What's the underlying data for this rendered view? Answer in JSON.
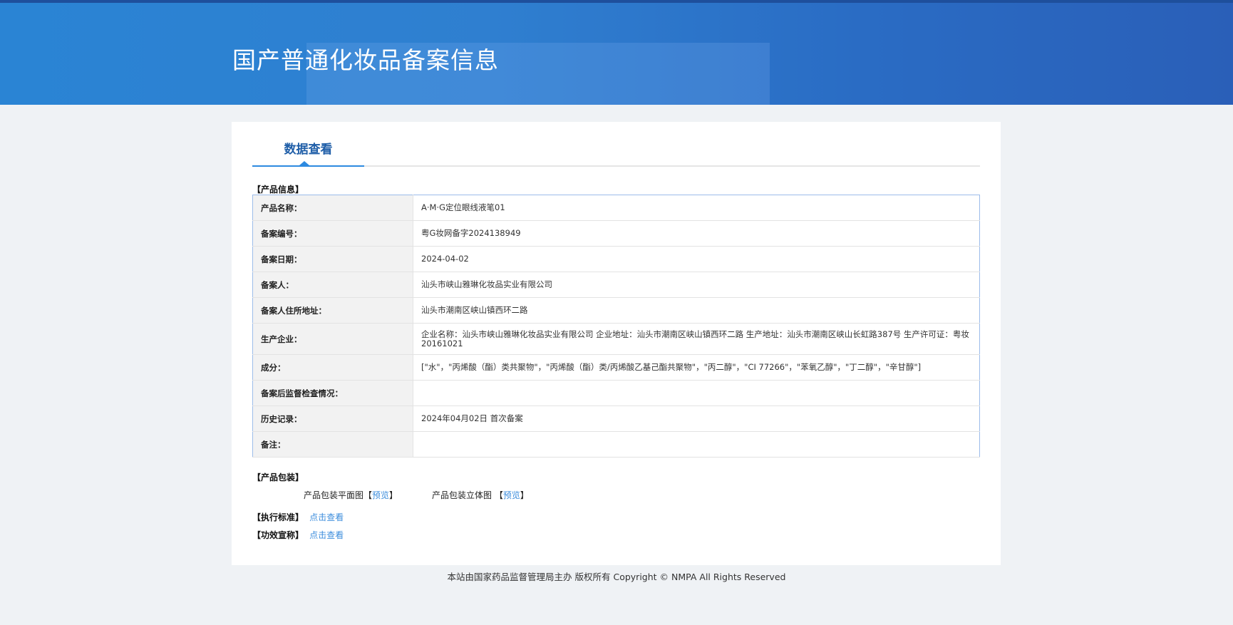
{
  "header": {
    "title": "国产普通化妆品备案信息"
  },
  "tab": {
    "label": "数据查看"
  },
  "product_info": {
    "heading": "【产品信息】",
    "rows": [
      {
        "label": "产品名称：",
        "value": "A·M·G定位眼线液笔01"
      },
      {
        "label": "备案编号：",
        "value": "粤G妆网备字2024138949"
      },
      {
        "label": "备案日期：",
        "value": "2024-04-02"
      },
      {
        "label": "备案人：",
        "value": "汕头市峡山雅琳化妆品实业有限公司"
      },
      {
        "label": "备案人住所地址：",
        "value": "汕头市潮南区峡山镇西环二路"
      },
      {
        "label": "生产企业：",
        "value": "企业名称：汕头市峡山雅琳化妆品实业有限公司 企业地址：汕头市潮南区峡山镇西环二路 生产地址：汕头市潮南区峡山长虹路387号 生产许可证：粤妆20161021"
      },
      {
        "label": "成分：",
        "value": "[\"水\"，\"丙烯酸（酯）类共聚物\"，\"丙烯酸（酯）类/丙烯酸乙基己酯共聚物\"，\"丙二醇\"，\"CI 77266\"，\"苯氧乙醇\"，\"丁二醇\"，\"辛甘醇\"]"
      },
      {
        "label": "备案后监督检查情况：",
        "value": ""
      },
      {
        "label": "历史记录：",
        "value": "2024年04月02日 首次备案"
      },
      {
        "label": "备注：",
        "value": ""
      }
    ]
  },
  "packaging": {
    "heading": "【产品包装】",
    "flat_label": "产品包装平面图",
    "flat_link": "预览",
    "solid_label": "产品包装立体图",
    "solid_link": "预览",
    "bracket_open": "【",
    "bracket_close": "】"
  },
  "standard": {
    "label": "【执行标准】",
    "link": "点击查看"
  },
  "claim": {
    "label": "【功效宣称】",
    "link": "点击查看"
  },
  "footer": {
    "text": "本站由国家药品监督管理局主办 版权所有 Copyright © NMPA All Rights Reserved"
  }
}
